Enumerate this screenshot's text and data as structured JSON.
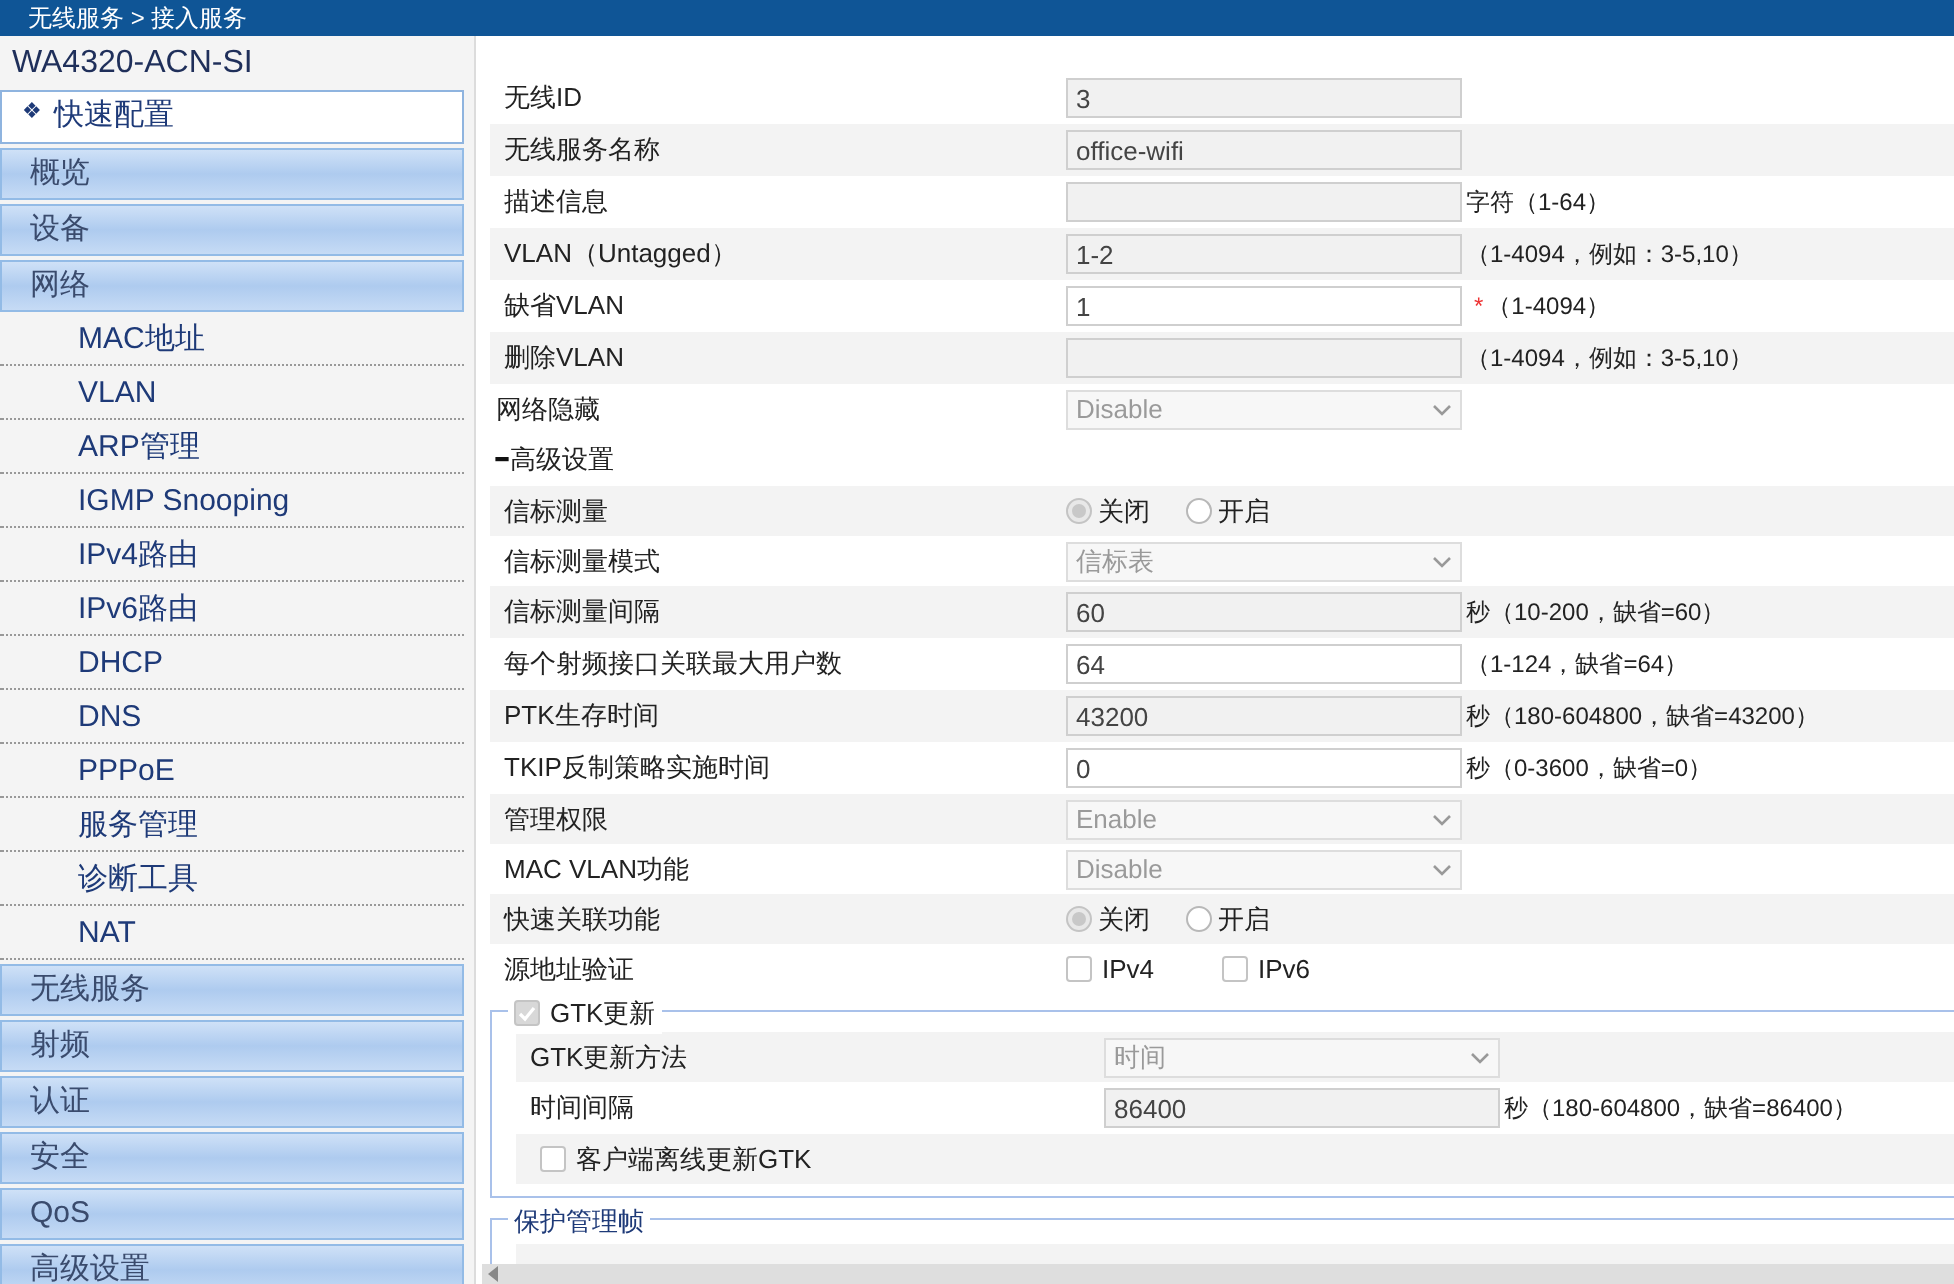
{
  "breadcrumb": "无线服务 > 接入服务",
  "sidebar": {
    "device": "WA4320-ACN-SI",
    "quick": {
      "icon": "❖",
      "label": "快速配置"
    },
    "items": [
      {
        "label": "概览"
      },
      {
        "label": "设备"
      },
      {
        "label": "网络",
        "children": [
          {
            "label": "MAC地址"
          },
          {
            "label": "VLAN"
          },
          {
            "label": "ARP管理"
          },
          {
            "label": "IGMP Snooping"
          },
          {
            "label": "IPv4路由"
          },
          {
            "label": "IPv6路由"
          },
          {
            "label": "DHCP"
          },
          {
            "label": "DNS"
          },
          {
            "label": "PPPoE"
          },
          {
            "label": "服务管理"
          },
          {
            "label": "诊断工具"
          },
          {
            "label": "NAT"
          }
        ]
      },
      {
        "label": "无线服务"
      },
      {
        "label": "射频"
      },
      {
        "label": "认证"
      },
      {
        "label": "安全"
      },
      {
        "label": "QoS"
      },
      {
        "label": "高级设置"
      }
    ]
  },
  "basic_fields": [
    {
      "kind": "input",
      "label": "无线ID",
      "value": "3",
      "disabled": true
    },
    {
      "kind": "input",
      "label": "无线服务名称",
      "value": "office-wifi",
      "disabled": true
    },
    {
      "kind": "input",
      "label": "描述信息",
      "disabled": true,
      "hint": "字符（1-64）"
    },
    {
      "kind": "input",
      "label": "VLAN（Untagged）",
      "value": "1-2",
      "disabled": true,
      "hint": "（1-4094，例如：3-5,10）"
    },
    {
      "kind": "input",
      "label": "缺省VLAN",
      "value": "1",
      "disabled": false,
      "required_mark": "*",
      "hint": "（1-4094）"
    },
    {
      "kind": "input",
      "label": "删除VLAN",
      "disabled": true,
      "hint": "（1-4094，例如：3-5,10）"
    }
  ],
  "hidden_network": {
    "label": "网络隐藏",
    "value": "Disable"
  },
  "advanced": {
    "toggle": "━",
    "title": "高级设置",
    "fields": [
      {
        "kind": "radio",
        "label": "信标测量",
        "options": [
          {
            "label": "关闭",
            "selected": true
          },
          {
            "label": "开启",
            "selected": false
          }
        ]
      },
      {
        "kind": "select",
        "label": "信标测量模式",
        "value": "信标表"
      },
      {
        "kind": "input",
        "label": "信标测量间隔",
        "value": "60",
        "disabled": true,
        "hint": "秒（10-200，缺省=60）"
      },
      {
        "kind": "input",
        "label": "每个射频接口关联最大用户数",
        "value": "64",
        "disabled": false,
        "hint": "（1-124，缺省=64）"
      },
      {
        "kind": "input",
        "label": "PTK生存时间",
        "value": "43200",
        "disabled": true,
        "hint": "秒（180-604800，缺省=43200）"
      },
      {
        "kind": "input",
        "label": "TKIP反制策略实施时间",
        "value": "0",
        "disabled": false,
        "hint": "秒（0-3600，缺省=0）"
      },
      {
        "kind": "select",
        "label": "管理权限",
        "value": "Enable"
      },
      {
        "kind": "select",
        "label": "MAC VLAN功能",
        "value": "Disable"
      },
      {
        "kind": "radio",
        "label": "快速关联功能",
        "options": [
          {
            "label": "关闭",
            "selected": true
          },
          {
            "label": "开启",
            "selected": false
          }
        ]
      },
      {
        "kind": "checks",
        "label": "源地址验证",
        "options": [
          {
            "label": "IPv4",
            "checked": false
          },
          {
            "label": "IPv6",
            "checked": false
          }
        ]
      }
    ]
  },
  "gtk": {
    "legend": "GTK更新",
    "checked": true,
    "fields": [
      {
        "kind": "select",
        "label": "GTK更新方法",
        "value": "时间"
      },
      {
        "kind": "input",
        "label": "时间间隔",
        "value": "86400",
        "disabled": true,
        "hint": "秒（180-604800，缺省=86400）"
      },
      {
        "kind": "check",
        "label": "客户端离线更新GTK",
        "checked": false
      }
    ]
  },
  "pmf": {
    "legend": "保护管理帧"
  }
}
